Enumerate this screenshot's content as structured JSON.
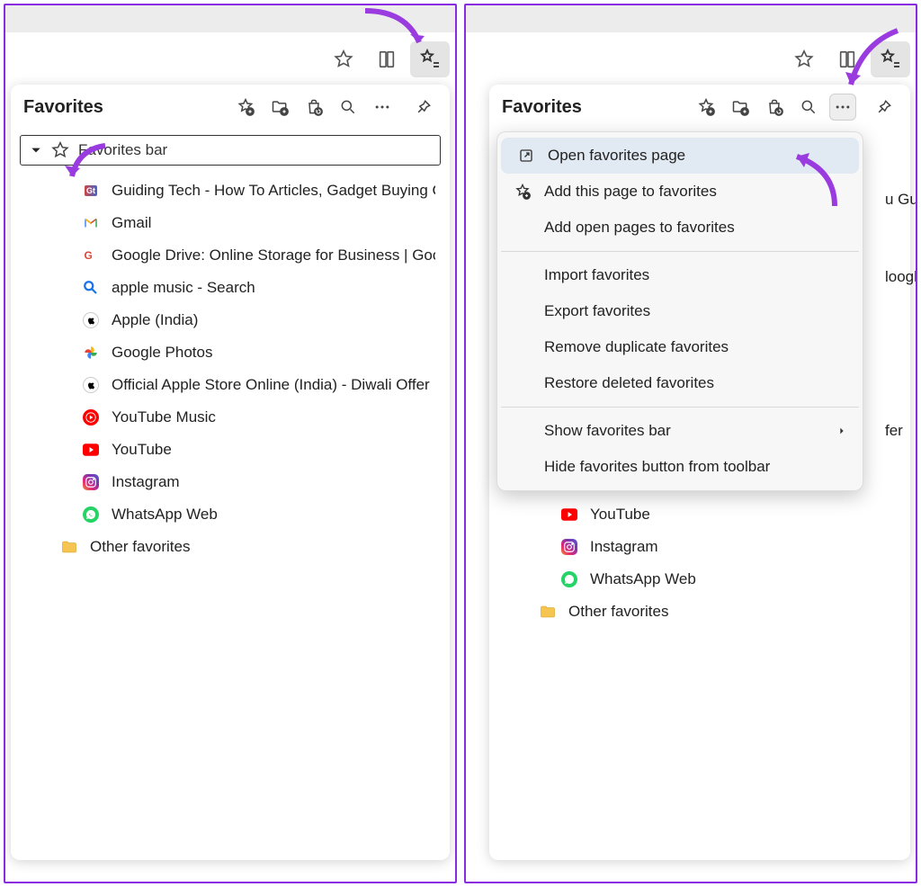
{
  "panels": {
    "left": {
      "favorites_title": "Favorites",
      "favorites_bar_label": "Favorites bar",
      "other_favorites_label": "Other favorites",
      "items": [
        {
          "icon": "gt",
          "label": "Guiding Tech - How To Articles, Gadget Buying Guid"
        },
        {
          "icon": "gmail",
          "label": "Gmail"
        },
        {
          "icon": "gdrive",
          "label": "Google Drive: Online Storage for Business | Google"
        },
        {
          "icon": "search",
          "label": "apple music - Search"
        },
        {
          "icon": "apple",
          "label": "Apple (India)"
        },
        {
          "icon": "gphotos",
          "label": "Google Photos"
        },
        {
          "icon": "apple",
          "label": "Official Apple Store Online (India) - Diwali Offer"
        },
        {
          "icon": "ytmusic",
          "label": "YouTube Music"
        },
        {
          "icon": "youtube",
          "label": "YouTube"
        },
        {
          "icon": "instagram",
          "label": "Instagram"
        },
        {
          "icon": "whatsapp",
          "label": "WhatsApp Web"
        }
      ]
    },
    "right": {
      "favorites_title": "Favorites",
      "other_favorites_label": "Other favorites",
      "partial_texts": {
        "row1": "u Guid",
        "row2": "loogle",
        "row3": "fer"
      },
      "visible_items": [
        {
          "icon": "youtube",
          "label": "YouTube"
        },
        {
          "icon": "instagram",
          "label": "Instagram"
        },
        {
          "icon": "whatsapp",
          "label": "WhatsApp Web"
        }
      ],
      "context_menu": {
        "open_favorites_page": "Open favorites page",
        "add_page": "Add this page to favorites",
        "add_open_pages": "Add open pages to favorites",
        "import_favorites": "Import favorites",
        "export_favorites": "Export favorites",
        "remove_duplicates": "Remove duplicate favorites",
        "restore_deleted": "Restore deleted favorites",
        "show_favorites_bar": "Show favorites bar",
        "hide_favorites_button": "Hide favorites button from toolbar"
      }
    }
  }
}
